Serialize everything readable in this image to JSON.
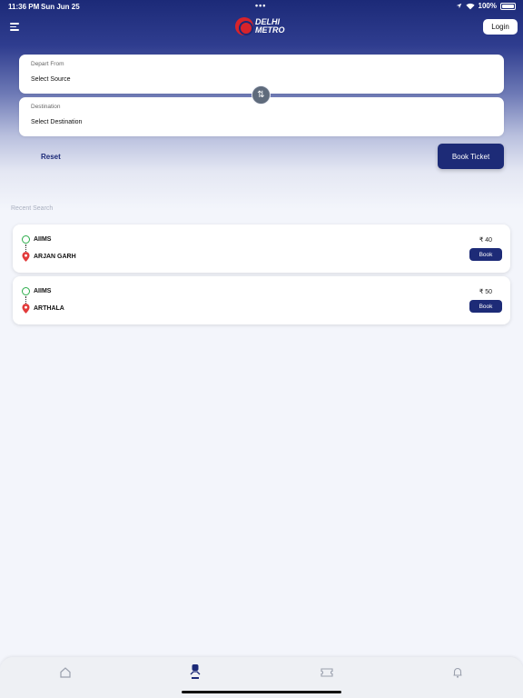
{
  "status": {
    "time": "11:36 PM",
    "date": "Sun Jun 25",
    "dots": "•••",
    "battery": "100%"
  },
  "header": {
    "logo_line1": "DELHI",
    "logo_line2": "METRO",
    "login_label": "Login"
  },
  "form": {
    "depart_label": "Depart From",
    "depart_value": "Select Source",
    "destination_label": "Destination",
    "destination_value": "Select Destination",
    "swap_icon": "⇅",
    "reset_label": "Reset",
    "book_ticket_label": "Book Ticket"
  },
  "recent": {
    "title": "Recent Search",
    "items": [
      {
        "from": "AIIMS",
        "to": "ARJAN GARH",
        "fare": "₹ 40",
        "book_label": "Book"
      },
      {
        "from": "AIIMS",
        "to": "ARTHALA",
        "fare": "₹ 50",
        "book_label": "Book"
      }
    ]
  },
  "tabs": [
    "home-icon",
    "metro-icon",
    "ticket-icon",
    "bell-icon"
  ],
  "colors": {
    "primary": "#1d2b77",
    "source_green": "#2bac4a",
    "destination_red": "#e23b3b"
  }
}
